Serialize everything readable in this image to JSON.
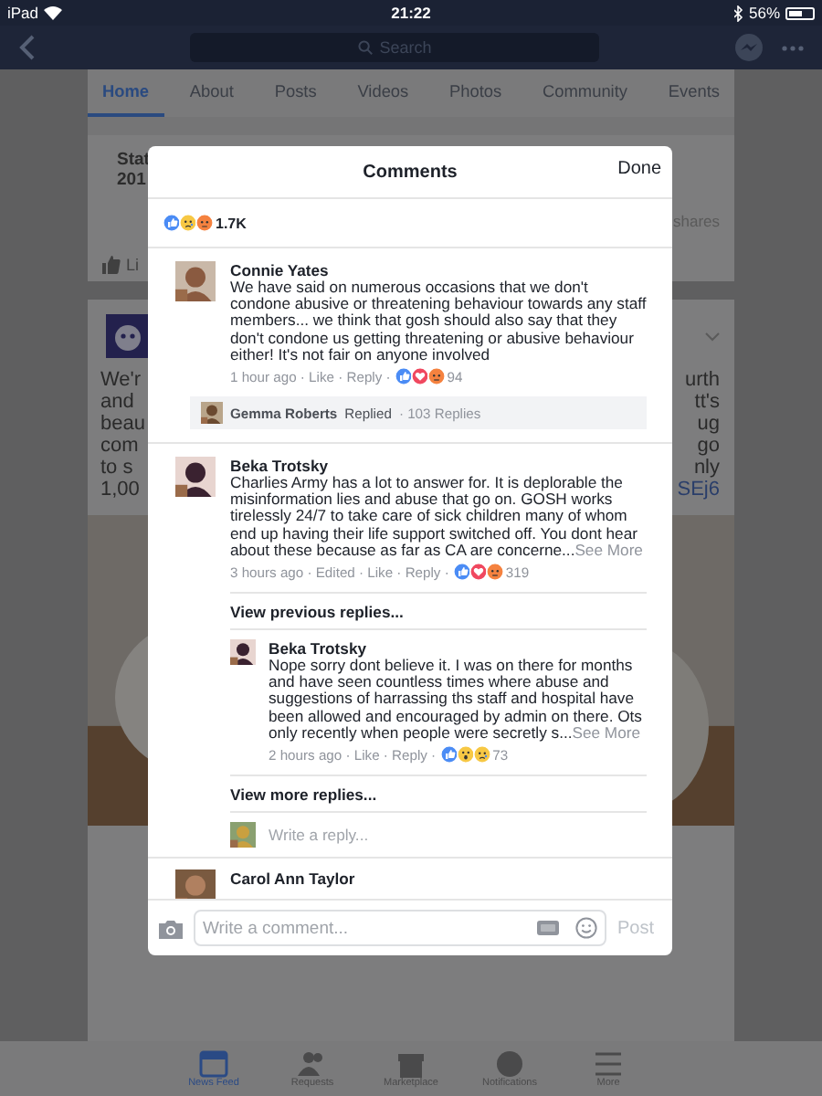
{
  "status_bar": {
    "carrier": "iPad",
    "time": "21:22",
    "battery": "56%"
  },
  "nav": {
    "search_placeholder": "Search"
  },
  "tabs": [
    {
      "label": "Home",
      "selected": true
    },
    {
      "label": "About",
      "selected": false
    },
    {
      "label": "Posts",
      "selected": false
    },
    {
      "label": "Videos",
      "selected": false
    },
    {
      "label": "Photos",
      "selected": false
    },
    {
      "label": "Community",
      "selected": false
    },
    {
      "label": "Events",
      "selected": false
    }
  ],
  "post_1": {
    "left_lines": [
      "Stat",
      "201"
    ],
    "right_text": "shares",
    "action": "Li"
  },
  "post_2": {
    "left_lines": [
      "We'r",
      "and",
      "beau",
      "com",
      "to s",
      "1,00"
    ],
    "right_lines": [
      "urth",
      "tt's",
      "ug",
      "go",
      "nly",
      "SEj6"
    ]
  },
  "modal": {
    "title": "Comments",
    "done": "Done",
    "reaction_count": "1.7K",
    "comments": [
      {
        "kind": "comment",
        "author": "Connie Yates",
        "text": "We have said on numerous occasions that we don't condone abusive or threatening behaviour towards any staff members... we think that gosh should also say that they don't condone us getting threatening or abusive behaviour either! It's not fair on anyone involved",
        "meta": "1 hour ago · Like · Reply ·",
        "reaction_count": "94",
        "reply_summary": {
          "author": "Gemma Roberts",
          "action": "Replied",
          "count": "· 103 Replies"
        }
      },
      {
        "kind": "thread",
        "author": "Beka Trotsky",
        "text": "Charlies Army has a lot to answer for. It is deplorable the misinformation lies and abuse that go on. GOSH works tirelessly 24/7 to take care of sick children many of whom end up having their life support switched off. You dont hear about these because as far as CA are concerne...",
        "see_more": "See More",
        "meta": "3 hours ago · Edited · Like · Reply ·",
        "reaction_count": "319",
        "view_previous": "View previous replies...",
        "replies": [
          {
            "author": "Beka Trotsky",
            "text": "Nope sorry dont believe it. I was on there for months and have seen countless times where abuse and suggestions of harrassing ths staff and hospital have been allowed and encouraged by admin on there. Ots only recently when people were secretly s...",
            "see_more": "See More",
            "meta": "2 hours ago · Like · Reply ·",
            "reaction_count": "73"
          }
        ],
        "view_more": "View more replies...",
        "reply_placeholder": "Write a reply..."
      },
      {
        "kind": "cut",
        "author": "Carol Ann Taylor"
      }
    ],
    "composer": {
      "placeholder": "Write a comment...",
      "post": "Post"
    }
  },
  "bottom_bar": [
    {
      "label": "News Feed",
      "selected": true
    },
    {
      "label": "Requests",
      "selected": false
    },
    {
      "label": "Marketplace",
      "selected": false
    },
    {
      "label": "Notifications",
      "selected": false
    },
    {
      "label": "More",
      "selected": false
    }
  ]
}
